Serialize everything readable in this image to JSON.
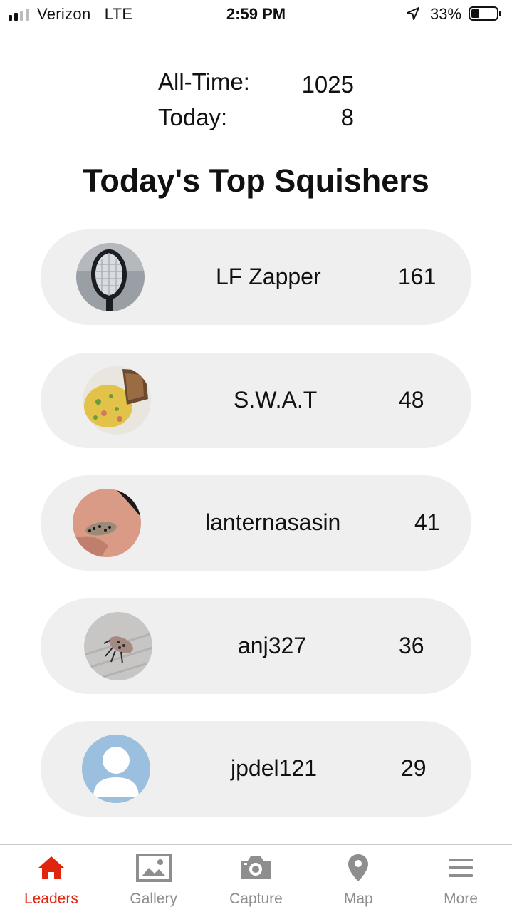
{
  "status_bar": {
    "carrier": "Verizon",
    "network": "LTE",
    "time": "2:59 PM",
    "battery": "33%",
    "icons": [
      "signal-icon",
      "location-arrow-icon",
      "battery-icon"
    ]
  },
  "stats": {
    "all_time_label": "All-Time:",
    "all_time_value": "1025",
    "today_label": "Today:",
    "today_value": "8"
  },
  "heading": "Today's Top Squishers",
  "leaders": [
    {
      "name": "LF Zapper",
      "score": "161",
      "avatar": "bug-zapper-racket-photo"
    },
    {
      "name": "S.W.A.T",
      "score": "48",
      "avatar": "omelette-toast-photo"
    },
    {
      "name": "lanternasasin",
      "score": "41",
      "avatar": "lanternfly-on-hand-photo"
    },
    {
      "name": "anj327",
      "score": "36",
      "avatar": "lanternfly-on-deck-photo"
    },
    {
      "name": "jpdel121",
      "score": "29",
      "avatar": "default-user-avatar"
    }
  ],
  "tabs": [
    {
      "label": "Leaders",
      "icon": "home-icon",
      "active": true
    },
    {
      "label": "Gallery",
      "icon": "image-icon",
      "active": false
    },
    {
      "label": "Capture",
      "icon": "camera-icon",
      "active": false
    },
    {
      "label": "Map",
      "icon": "map-pin-icon",
      "active": false
    },
    {
      "label": "More",
      "icon": "menu-icon",
      "active": false
    }
  ],
  "colors": {
    "accent": "#e0250e",
    "inactive": "#8e8e8e",
    "row_background": "#efefef"
  }
}
